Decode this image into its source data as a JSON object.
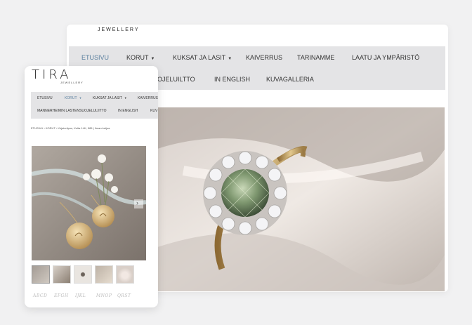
{
  "desktop": {
    "brand": "JEWELLERY",
    "nav_row1": [
      {
        "label": "ETUSIVU",
        "active": true
      },
      {
        "label": "KORUT",
        "caret": true
      },
      {
        "label": "KUKSAT JA LASIT",
        "caret": true
      },
      {
        "label": "KAIVERRUS"
      },
      {
        "label": "TARINAMME"
      },
      {
        "label": "LAATU JA YMPÄRISTÖ"
      }
    ],
    "nav_row2": [
      {
        "label": "OJELUILTTO"
      },
      {
        "label": "IN ENGLISH"
      },
      {
        "label": "KUVAGALLERIA"
      }
    ]
  },
  "mobile": {
    "logo": "TIRA",
    "logo_sub": "JEWELLERY",
    "nav_row1": [
      {
        "label": "ETUSIVU"
      },
      {
        "label": "KORUT",
        "caret": true,
        "active": true
      },
      {
        "label": "KUKSAT JA LASIT",
        "caret": true
      },
      {
        "label": "KAIVERRUS"
      }
    ],
    "nav_row2": [
      {
        "label": "MANNERHEIMIN LASTENSUOJELULIITTO"
      },
      {
        "label": "IN ENGLISH"
      },
      {
        "label": "KUV"
      }
    ],
    "breadcrumb": "ETUSIVU  ›  KORUT  ›  Kirjainriipus, Kulta 14K, 585 | Ilman ketjua",
    "engravings": [
      "ABCD",
      "EFGH",
      "IJKL",
      "MNOP",
      "QRST"
    ]
  },
  "colors": {
    "nav_bg": "#e4e4e6",
    "active": "#5a7f9e",
    "page_bg": "#f1f1f2"
  }
}
